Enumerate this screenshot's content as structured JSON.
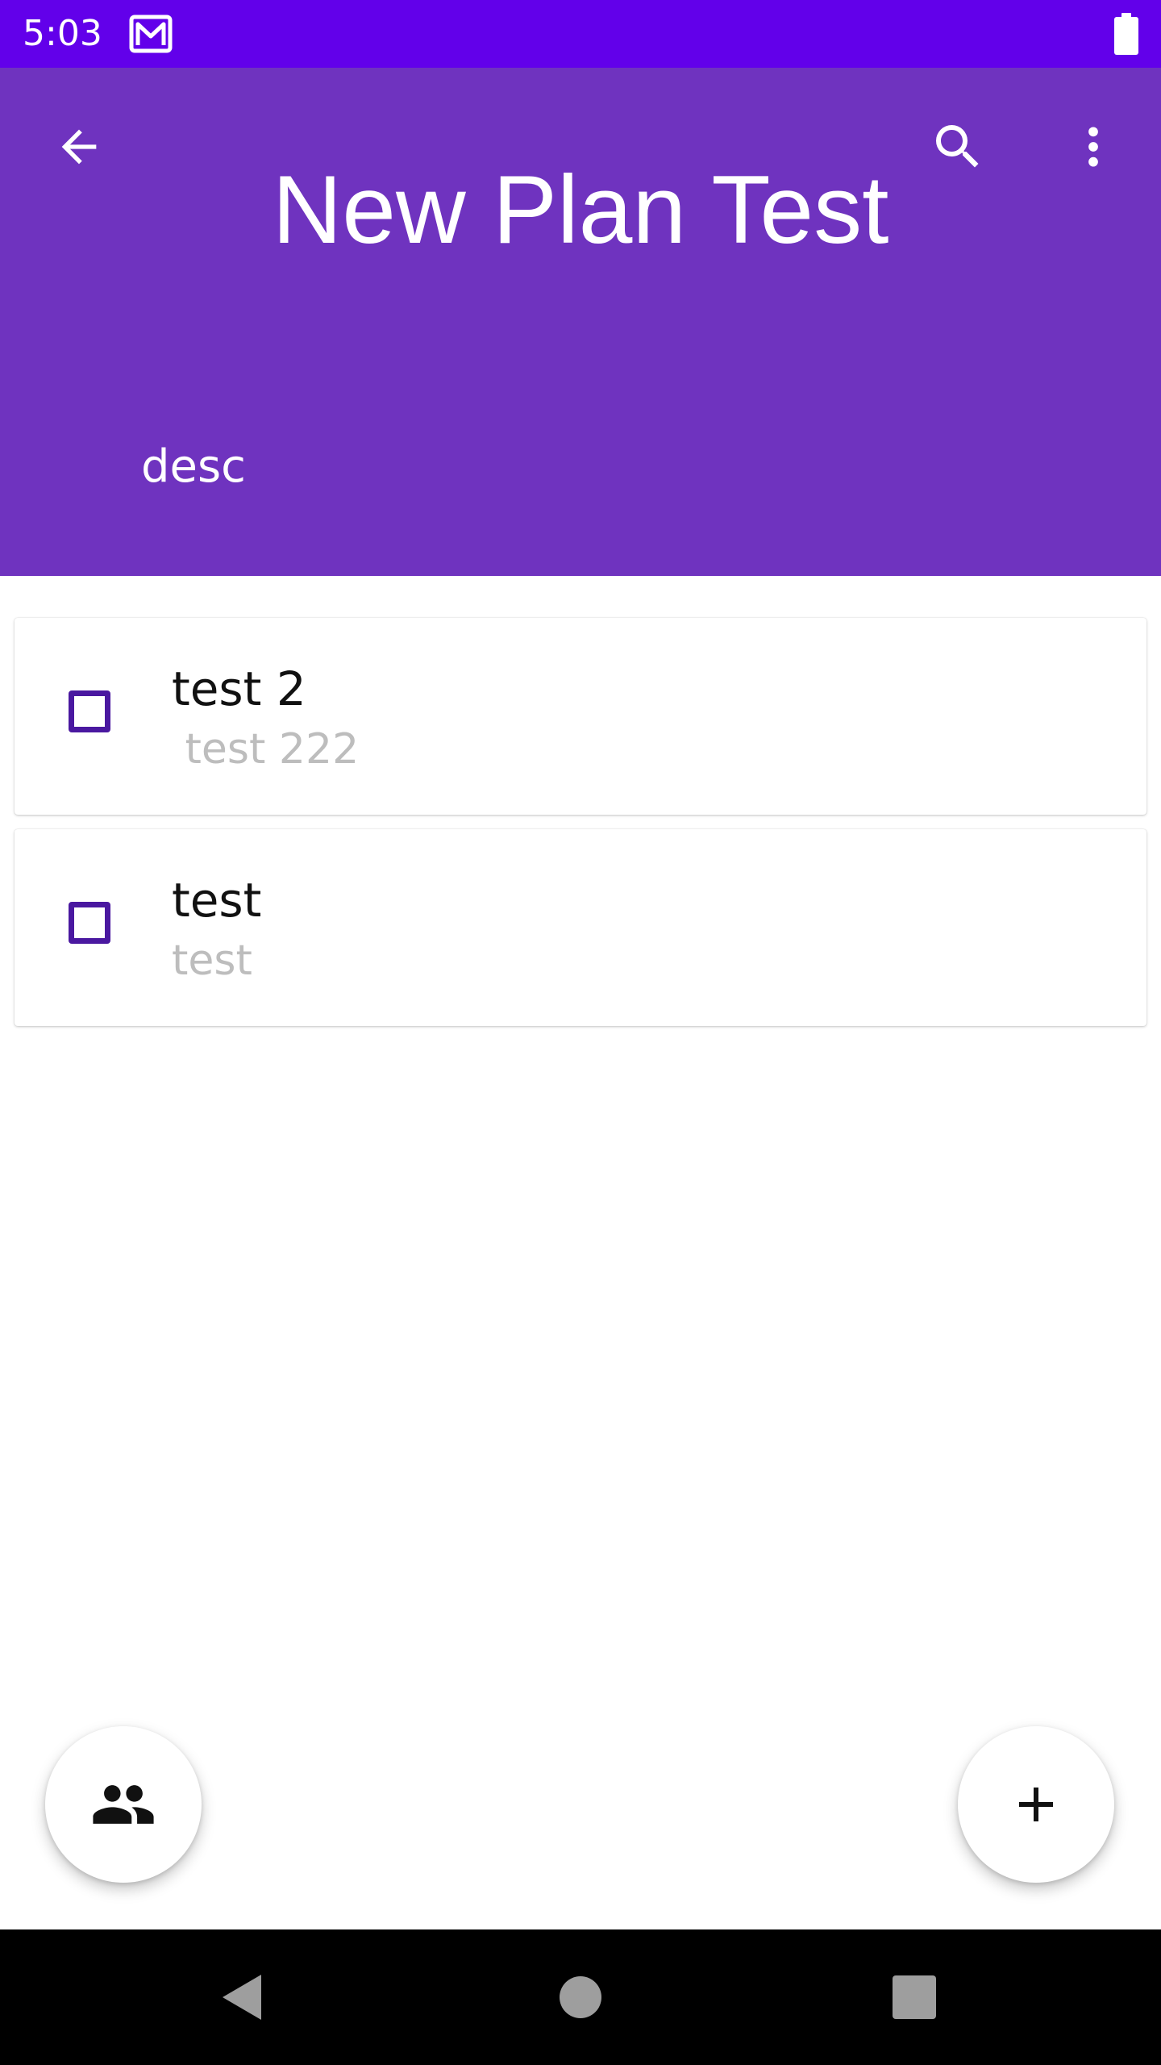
{
  "status_bar": {
    "time": "5:03",
    "notification_icon": "gmail-icon",
    "battery_icon": "battery-full-icon",
    "background": "#6200ea"
  },
  "app_bar": {
    "title": "New Plan Test",
    "description": "desc",
    "background": "#6f33bf",
    "icons": {
      "back": "arrow-back-icon",
      "search": "search-icon",
      "more": "more-vert-icon"
    }
  },
  "items": [
    {
      "title": "test 2",
      "subtitle": " test 222",
      "checked": false
    },
    {
      "title": "test",
      "subtitle": "test",
      "checked": false
    }
  ],
  "fabs": {
    "left_icon": "people-icon",
    "right_icon": "add-icon"
  },
  "nav_bar": {
    "back_icon": "nav-back-icon",
    "home_icon": "nav-home-icon",
    "recents_icon": "nav-recents-icon"
  },
  "colors": {
    "accent": "#4a18a0",
    "subtitle_text": "#bdbdbd"
  }
}
